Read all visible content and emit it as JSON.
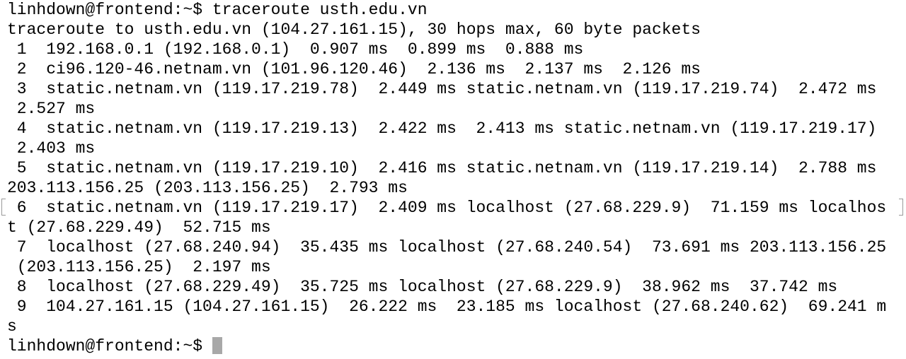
{
  "terminal": {
    "lines": [
      "linhdown@frontend:~$ traceroute usth.edu.vn",
      "traceroute to usth.edu.vn (104.27.161.15), 30 hops max, 60 byte packets",
      " 1  192.168.0.1 (192.168.0.1)  0.907 ms  0.899 ms  0.888 ms",
      " 2  ci96.120-46.netnam.vn (101.96.120.46)  2.136 ms  2.137 ms  2.126 ms",
      " 3  static.netnam.vn (119.17.219.78)  2.449 ms static.netnam.vn (119.17.219.74)  2.472 ms",
      " 2.527 ms",
      " 4  static.netnam.vn (119.17.219.13)  2.422 ms  2.413 ms static.netnam.vn (119.17.219.17)",
      " 2.403 ms",
      " 5  static.netnam.vn (119.17.219.10)  2.416 ms static.netnam.vn (119.17.219.14)  2.788 ms",
      "203.113.156.25 (203.113.156.25)  2.793 ms",
      " 6  static.netnam.vn (119.17.219.17)  2.409 ms localhost (27.68.229.9)  71.159 ms localhos",
      "t (27.68.229.49)  52.715 ms",
      " 7  localhost (27.68.240.94)  35.435 ms localhost (27.68.240.54)  73.691 ms 203.113.156.25",
      " (203.113.156.25)  2.197 ms",
      " 8  localhost (27.68.229.49)  35.725 ms localhost (27.68.229.9)  38.962 ms  37.742 ms",
      " 9  104.27.161.15 (104.27.161.15)  26.222 ms  23.185 ms localhost (27.68.240.62)  69.241 m",
      "s"
    ],
    "prompt": "linhdown@frontend:~$ "
  }
}
